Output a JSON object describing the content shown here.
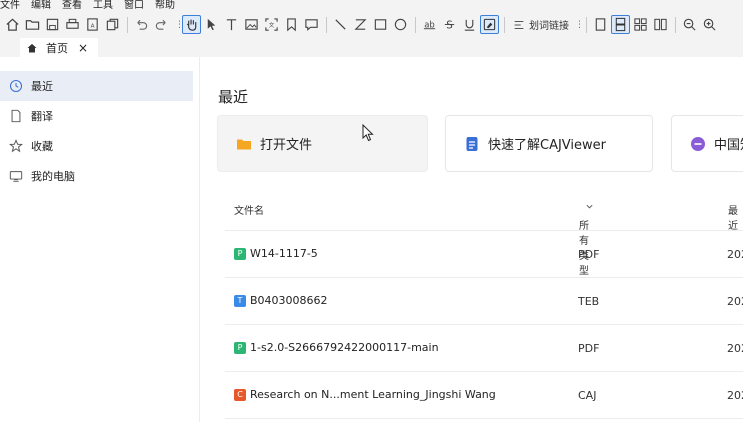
{
  "menu": [
    "文件",
    "编辑",
    "查看",
    "工具",
    "窗口",
    "帮助"
  ],
  "toolbar": {
    "link_label": "划词链接",
    "icons": [
      "home-icon",
      "open-folder-icon",
      "save-icon",
      "print-icon",
      "export-icon",
      "copy-page-icon",
      "undo-icon",
      "redo-icon",
      "hand-tool-icon",
      "select-arrow-icon",
      "text-tool-icon",
      "image-tool-icon",
      "ocr-tool-icon",
      "bookmark-icon",
      "comment-icon",
      "line-tool-icon",
      "curve-tool-icon",
      "rectangle-tool-icon",
      "ellipse-tool-icon",
      "strikethrough-icon",
      "strike-s-icon",
      "underline-icon",
      "highlight-icon",
      "single-page-icon",
      "continuous-page-icon",
      "grid-view-icon",
      "two-page-icon",
      "zoom-out-icon",
      "zoom-in-icon"
    ]
  },
  "tabs": [
    {
      "label": "首页",
      "close": "×"
    }
  ],
  "sidebar": {
    "items": [
      {
        "label": "最近",
        "icon": "clock-icon",
        "active": true
      },
      {
        "label": "翻译",
        "icon": "document-icon",
        "active": false
      },
      {
        "label": "收藏",
        "icon": "star-icon",
        "active": false
      },
      {
        "label": "我的电脑",
        "icon": "computer-icon",
        "active": false
      }
    ]
  },
  "main": {
    "title": "最近",
    "cards": [
      {
        "label": "打开文件",
        "icon": "folder-icon",
        "color": "#f5a623"
      },
      {
        "label": "快速了解CAJViewer",
        "icon": "doc-blue-icon",
        "color": "#3b6fd8"
      },
      {
        "label": "中国知",
        "icon": "cnki-icon",
        "color": "#8a5cd6"
      }
    ],
    "table": {
      "headers": {
        "name": "文件名",
        "type": "所有类型",
        "date": "最近"
      },
      "rows": [
        {
          "badge": "P",
          "badge_color": "#2bb673",
          "name": "W14-1117-5",
          "type": "PDF",
          "date": "202"
        },
        {
          "badge": "T",
          "badge_color": "#3a8be8",
          "name": "B0403008662",
          "type": "TEB",
          "date": "202"
        },
        {
          "badge": "P",
          "badge_color": "#2bb673",
          "name": "1-s2.0-S2666792422000117-main",
          "type": "PDF",
          "date": "202"
        },
        {
          "badge": "C",
          "badge_color": "#e8572a",
          "name": "Research on N...ment Learning_Jingshi Wang",
          "type": "CAJ",
          "date": "202"
        }
      ]
    }
  }
}
